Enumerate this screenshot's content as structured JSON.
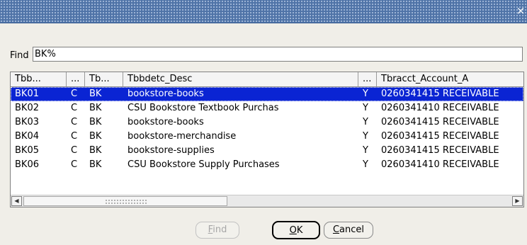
{
  "titlebar": {
    "close_icon": "close-icon",
    "close_glyph": "×"
  },
  "find": {
    "label": "Find",
    "value": "BK%"
  },
  "grid": {
    "columns": [
      "Tbb...",
      "...",
      "Tb...",
      "Tbbdetc_Desc",
      "...",
      "Tbracct_Account_A"
    ],
    "selected_row": 0,
    "rows": [
      [
        "BK01",
        "C",
        "BK",
        "bookstore-books",
        "Y",
        "0260341415 RECEIVABLE"
      ],
      [
        "BK02",
        "C",
        "BK",
        "CSU Bookstore Textbook Purchas",
        "Y",
        "0260341410 RECEIVABLE"
      ],
      [
        "BK03",
        "C",
        "BK",
        "bookstore-books",
        "Y",
        "0260341415 RECEIVABLE"
      ],
      [
        "BK04",
        "C",
        "BK",
        "bookstore-merchandise",
        "Y",
        "0260341415 RECEIVABLE"
      ],
      [
        "BK05",
        "C",
        "BK",
        "bookstore-supplies",
        "Y",
        "0260341415 RECEIVABLE"
      ],
      [
        "BK06",
        "C",
        "BK",
        "CSU Bookstore Supply Purchases",
        "Y",
        "0260341410 RECEIVABLE"
      ]
    ]
  },
  "buttons": {
    "find": {
      "first": "F",
      "rest": "ind",
      "enabled": false
    },
    "ok": {
      "first": "O",
      "rest": "K"
    },
    "cancel": {
      "first": "C",
      "rest": "ancel"
    }
  },
  "colors": {
    "titlebar": "#4f73a7",
    "selection": "#0a24d3",
    "window_bg": "#f0eee8"
  }
}
